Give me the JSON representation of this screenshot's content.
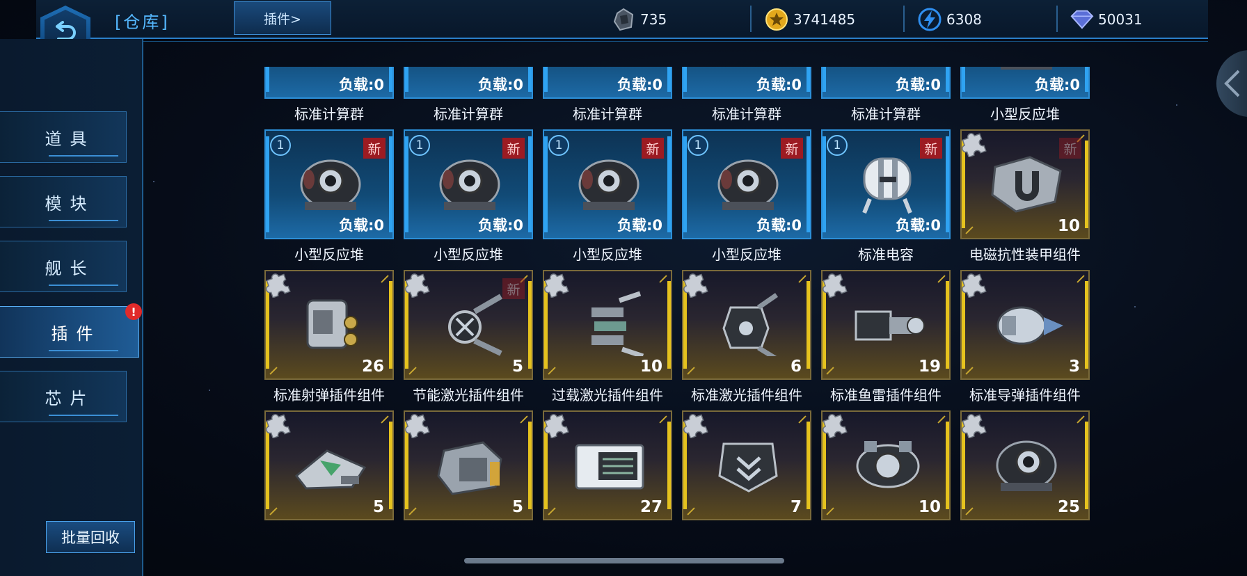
{
  "header": {
    "title": "[仓库]",
    "tab_label": "插件>",
    "resources": [
      {
        "icon": "ore-icon",
        "value": "735"
      },
      {
        "icon": "coin-icon",
        "value": "3741485"
      },
      {
        "icon": "energy-icon",
        "value": "6308"
      },
      {
        "icon": "crystal-icon",
        "value": "50031"
      }
    ]
  },
  "sidebar": {
    "items": [
      {
        "label": "道具",
        "active": false
      },
      {
        "label": "模块",
        "active": false
      },
      {
        "label": "舰长",
        "active": false
      },
      {
        "label": "插件",
        "active": true,
        "alert": "!"
      },
      {
        "label": "芯片",
        "active": false
      }
    ],
    "recycle_label": "批量回收"
  },
  "grid": {
    "items": [
      {
        "name": "标准计算群",
        "style": "blue",
        "load": "负载:0",
        "art": "calc"
      },
      {
        "name": "标准计算群",
        "style": "blue",
        "load": "负载:0",
        "art": "calc"
      },
      {
        "name": "标准计算群",
        "style": "blue",
        "load": "负载:0",
        "art": "calc"
      },
      {
        "name": "标准计算群",
        "style": "blue",
        "load": "负载:0",
        "art": "calc"
      },
      {
        "name": "标准计算群",
        "style": "blue",
        "load": "负载:0",
        "art": "calc"
      },
      {
        "name": "小型反应堆",
        "style": "blue",
        "load": "负载:0",
        "art": "reactor"
      },
      {
        "name": "小型反应堆",
        "style": "blue",
        "level": "1",
        "new": "新",
        "load": "负载:0",
        "art": "reactor"
      },
      {
        "name": "小型反应堆",
        "style": "blue",
        "level": "1",
        "new": "新",
        "load": "负载:0",
        "art": "reactor"
      },
      {
        "name": "小型反应堆",
        "style": "blue",
        "level": "1",
        "new": "新",
        "load": "负载:0",
        "art": "reactor"
      },
      {
        "name": "小型反应堆",
        "style": "blue",
        "level": "1",
        "new": "新",
        "load": "负载:0",
        "art": "reactor"
      },
      {
        "name": "标准电容",
        "style": "blue",
        "level": "1",
        "new": "新",
        "load": "负载:0",
        "art": "capacitor"
      },
      {
        "name": "电磁抗性装甲组件",
        "style": "gold",
        "new": "新",
        "new_dim": true,
        "count": "10",
        "art": "armor"
      },
      {
        "name": "标准射弹插件组件",
        "style": "gold",
        "count": "26",
        "art": "projectile"
      },
      {
        "name": "节能激光插件组件",
        "style": "gold",
        "new": "新",
        "new_dim": true,
        "count": "5",
        "art": "laser"
      },
      {
        "name": "过载激光插件组件",
        "style": "gold",
        "count": "10",
        "art": "overload"
      },
      {
        "name": "标准激光插件组件",
        "style": "gold",
        "count": "6",
        "art": "laser2"
      },
      {
        "name": "标准鱼雷插件组件",
        "style": "gold",
        "count": "19",
        "art": "torpedo"
      },
      {
        "name": "标准导弹插件组件",
        "style": "gold",
        "count": "3",
        "art": "missile"
      },
      {
        "name": "",
        "style": "gold",
        "count": "5",
        "art": "ship"
      },
      {
        "name": "",
        "style": "gold",
        "count": "5",
        "art": "engine"
      },
      {
        "name": "",
        "style": "gold",
        "count": "27",
        "art": "box"
      },
      {
        "name": "",
        "style": "gold",
        "count": "7",
        "art": "shield"
      },
      {
        "name": "",
        "style": "gold",
        "count": "10",
        "art": "gyro"
      },
      {
        "name": "",
        "style": "gold",
        "count": "25",
        "art": "reactor2"
      }
    ]
  }
}
